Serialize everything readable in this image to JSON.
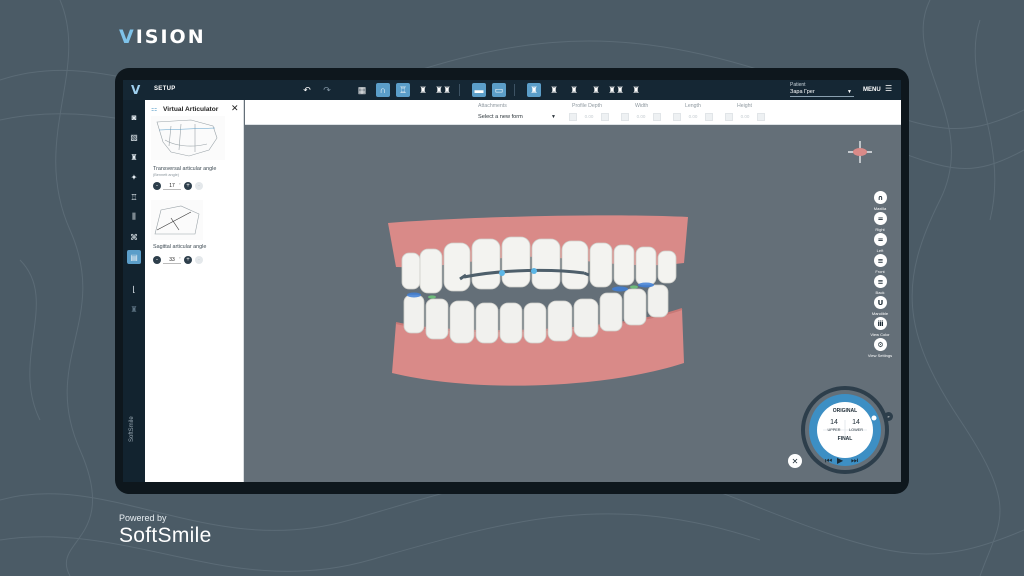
{
  "brand": {
    "vision_v": "V",
    "vision_rest": "ISION",
    "powered_by": "Powered by",
    "softsmile": "SoftSmile"
  },
  "topbar": {
    "logo": "V",
    "mode": "SETUP",
    "icons": [
      "undo-icon",
      "redo-icon",
      "grid-icon",
      "arch-icon",
      "tooth-icon",
      "tooth-single-icon",
      "teeth-pair-icon",
      "bracket-icon",
      "bracket-alt-icon",
      "tooth-front-icon",
      "tooth-side-icon",
      "tooth-root-icon",
      "tooth-crown-icon",
      "tooth-implant-icon"
    ],
    "patient_label": "Patient",
    "patient_value": "Зара Грег",
    "menu_label": "MENU"
  },
  "leftbar": {
    "vertical_brand": "SoftSmile"
  },
  "panel": {
    "title": "Virtual Articulator",
    "transversal_label": "Transversal articular angle",
    "transversal_sublabel": "(Bennett angle)",
    "transversal_value": "17",
    "sagittal_label": "Sagittal articular angle",
    "sagittal_value": "33",
    "degree": "°",
    "minus": "-",
    "plus": "+"
  },
  "topinfo": {
    "attachments_label": "Attachments",
    "attachments_value": "Select a new form",
    "profile_depth_label": "Profile Depth",
    "width_label": "Width",
    "length_label": "Length",
    "height_label": "Height",
    "placeholder": "0.00"
  },
  "right_tools": [
    {
      "label": "Maxilla",
      "icon": "∩"
    },
    {
      "label": "Right",
      "icon": "="
    },
    {
      "label": "Left",
      "icon": "="
    },
    {
      "label": "Front",
      "icon": "≡"
    },
    {
      "label": "Back",
      "icon": "≡"
    },
    {
      "label": "Mandible",
      "icon": "U"
    },
    {
      "label": "View Color",
      "icon": "ⅲ"
    },
    {
      "label": "View Settings",
      "icon": "⚙"
    }
  ],
  "dial": {
    "original": "ORIGINAL",
    "upper_count": "14",
    "lower_count": "14",
    "upper": "UPPER",
    "lower": "LOWER",
    "final": "FINAL"
  },
  "colors": {
    "accent": "#5b9ec9",
    "topbar": "#152734",
    "viewport": "#646f78",
    "gum": "#d98a88"
  }
}
